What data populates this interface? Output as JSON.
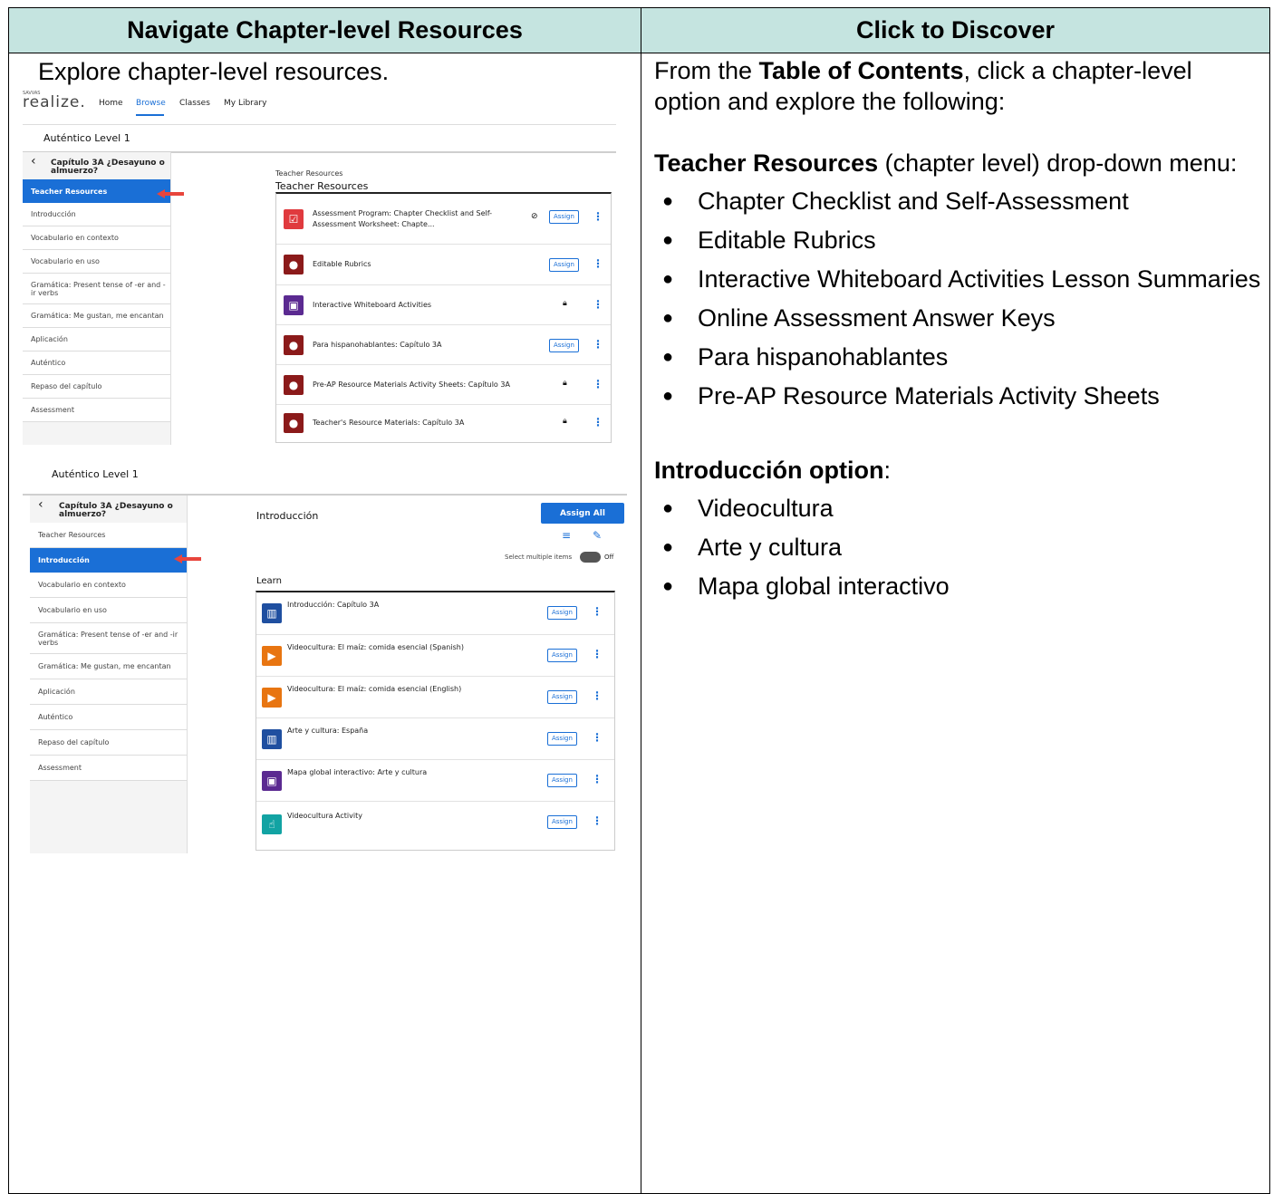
{
  "table": {
    "left_header": "Navigate Chapter-level Resources",
    "right_header": "Click to Discover",
    "intro": "Explore chapter-level resources."
  },
  "right_col": {
    "p1_pre": "From the ",
    "p1_bold": "Table of Contents",
    "p1_post": ", click a chapter-level option and explore the following:",
    "section1_bold": "Teacher Resources",
    "section1_post": " (chapter level) drop-down menu:",
    "list1": [
      "Chapter Checklist and Self-Assessment",
      "Editable Rubrics",
      "Interactive Whiteboard Activities Lesson Summaries",
      "Online Assessment Answer Keys",
      "Para hispanohablantes",
      "Pre-AP Resource Materials Activity Sheets"
    ],
    "section2_bold": "Introducción option",
    "section2_post": ":",
    "list2": [
      "Videocultura",
      "Arte y cultura",
      "Mapa global interactivo"
    ],
    "bullet": "●"
  },
  "shot1": {
    "logo_small": "SAVVAS",
    "logo": "realize.",
    "nav": [
      "Home",
      "Browse",
      "Classes",
      "My Library"
    ],
    "title": "Auténtico Level 1",
    "chapter": "Capítulo 3A ¿Desayuno o almuerzo?",
    "sidebar": [
      "Teacher Resources",
      "Introducción",
      "Vocabulario en contexto",
      "Vocabulario en uso",
      "Gramática: Present tense of -er and -ir verbs",
      "Gramática: Me gustan, me encantan",
      "Aplicación",
      "Auténtico",
      "Repaso del capítulo",
      "Assessment"
    ],
    "breadcrumb": "Teacher Resources",
    "content_title": "Teacher Resources",
    "assign": "Assign",
    "resources": [
      "Assessment Program: Chapter Checklist and Self-Assessment Worksheet: Chapte...",
      "Editable Rubrics",
      "Interactive Whiteboard Activities",
      "Para hispanohablantes: Capítulo 3A",
      "Pre-AP Resource Materials Activity Sheets: Capítulo 3A",
      "Teacher's Resource Materials: Capítulo 3A"
    ]
  },
  "shot2": {
    "title": "Auténtico Level 1",
    "chapter": "Capítulo 3A ¿Desayuno o almuerzo?",
    "sidebar": [
      "Teacher Resources",
      "Introducción",
      "Vocabulario en contexto",
      "Vocabulario en uso",
      "Gramática: Present tense of -er and -ir verbs",
      "Gramática: Me gustan, me encantan",
      "Aplicación",
      "Auténtico",
      "Repaso del capítulo",
      "Assessment"
    ],
    "content_title": "Introducción",
    "assign_all": "Assign All",
    "select_multiple": "Select multiple items",
    "toggle_state": "Off",
    "section": "Learn",
    "assign": "Assign",
    "resources": [
      "Introducción: Capítulo 3A",
      "Videocultura: El maíz: comida esencial (Spanish)",
      "Videocultura: El maíz: comida esencial (English)",
      "Arte y cultura: España",
      "Mapa global interactivo: Arte y cultura",
      "Videocultura Activity"
    ]
  },
  "colors": {
    "header_bg": "#c5e4e0",
    "accent": "#1a6fd6",
    "arrow": "#e8453c"
  }
}
